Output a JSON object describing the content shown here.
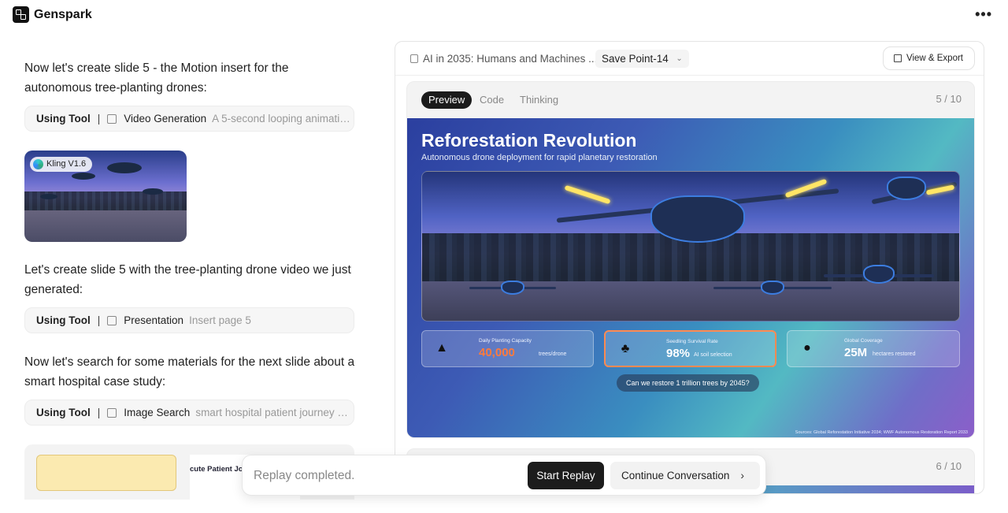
{
  "app": {
    "name": "Genspark",
    "more_label": "•••"
  },
  "chat": {
    "msg1": "Now let's create slide 5 - the Motion insert for the autonomous tree-planting drones:",
    "tool1": {
      "label": "Using Tool",
      "separator": "|",
      "name": "Video Generation",
      "desc": "A 5-second looping animation o..."
    },
    "video_badge": "Kling V1.6",
    "msg2": "Let's create slide 5 with the tree-planting drone video we just generated:",
    "tool2": {
      "label": "Using Tool",
      "separator": "|",
      "name": "Presentation",
      "desc": "Insert page 5"
    },
    "msg3": "Now let's search for some materials for the next slide about a smart hospital case study:",
    "tool3": {
      "label": "Using Tool",
      "separator": "|",
      "name": "Image Search",
      "desc": "smart hospital patient journey diagr..."
    },
    "image_result_2_text": "cute Patient Jo"
  },
  "replay": {
    "status": "Replay completed.",
    "start_label": "Start Replay",
    "continue_label": "Continue Conversation",
    "continue_icon": "chevron-right-icon"
  },
  "panel": {
    "doc_title": "AI in 2035: Humans and Machines ...",
    "save_point": "Save Point-14",
    "view_export": "View & Export",
    "tabs": [
      "Preview",
      "Code",
      "Thinking"
    ],
    "active_tab": "Preview",
    "page": "5 / 10",
    "next_page": "6 / 10"
  },
  "slide": {
    "title": "Reforestation Revolution",
    "subtitle": "Autonomous drone deployment for rapid planetary restoration",
    "stats": [
      {
        "label": "Daily Planting Capacity",
        "value": "40,000",
        "unit": "trees/drone",
        "icon": "tree-icon",
        "color": "#ff7a3d"
      },
      {
        "label": "Seedling Survival Rate",
        "value": "98%",
        "unit": "AI soil selection",
        "icon": "sprout-icon",
        "color": "#ffffff"
      },
      {
        "label": "Global Coverage",
        "value": "25M",
        "unit": "hectares restored",
        "icon": "globe-icon",
        "color": "#ffffff"
      }
    ],
    "question": "Can we restore 1 trillion trees by 2045?",
    "sources": "Sources: Global Reforestation Initiative 2034; WWF Autonomous Restoration Report 2033"
  }
}
